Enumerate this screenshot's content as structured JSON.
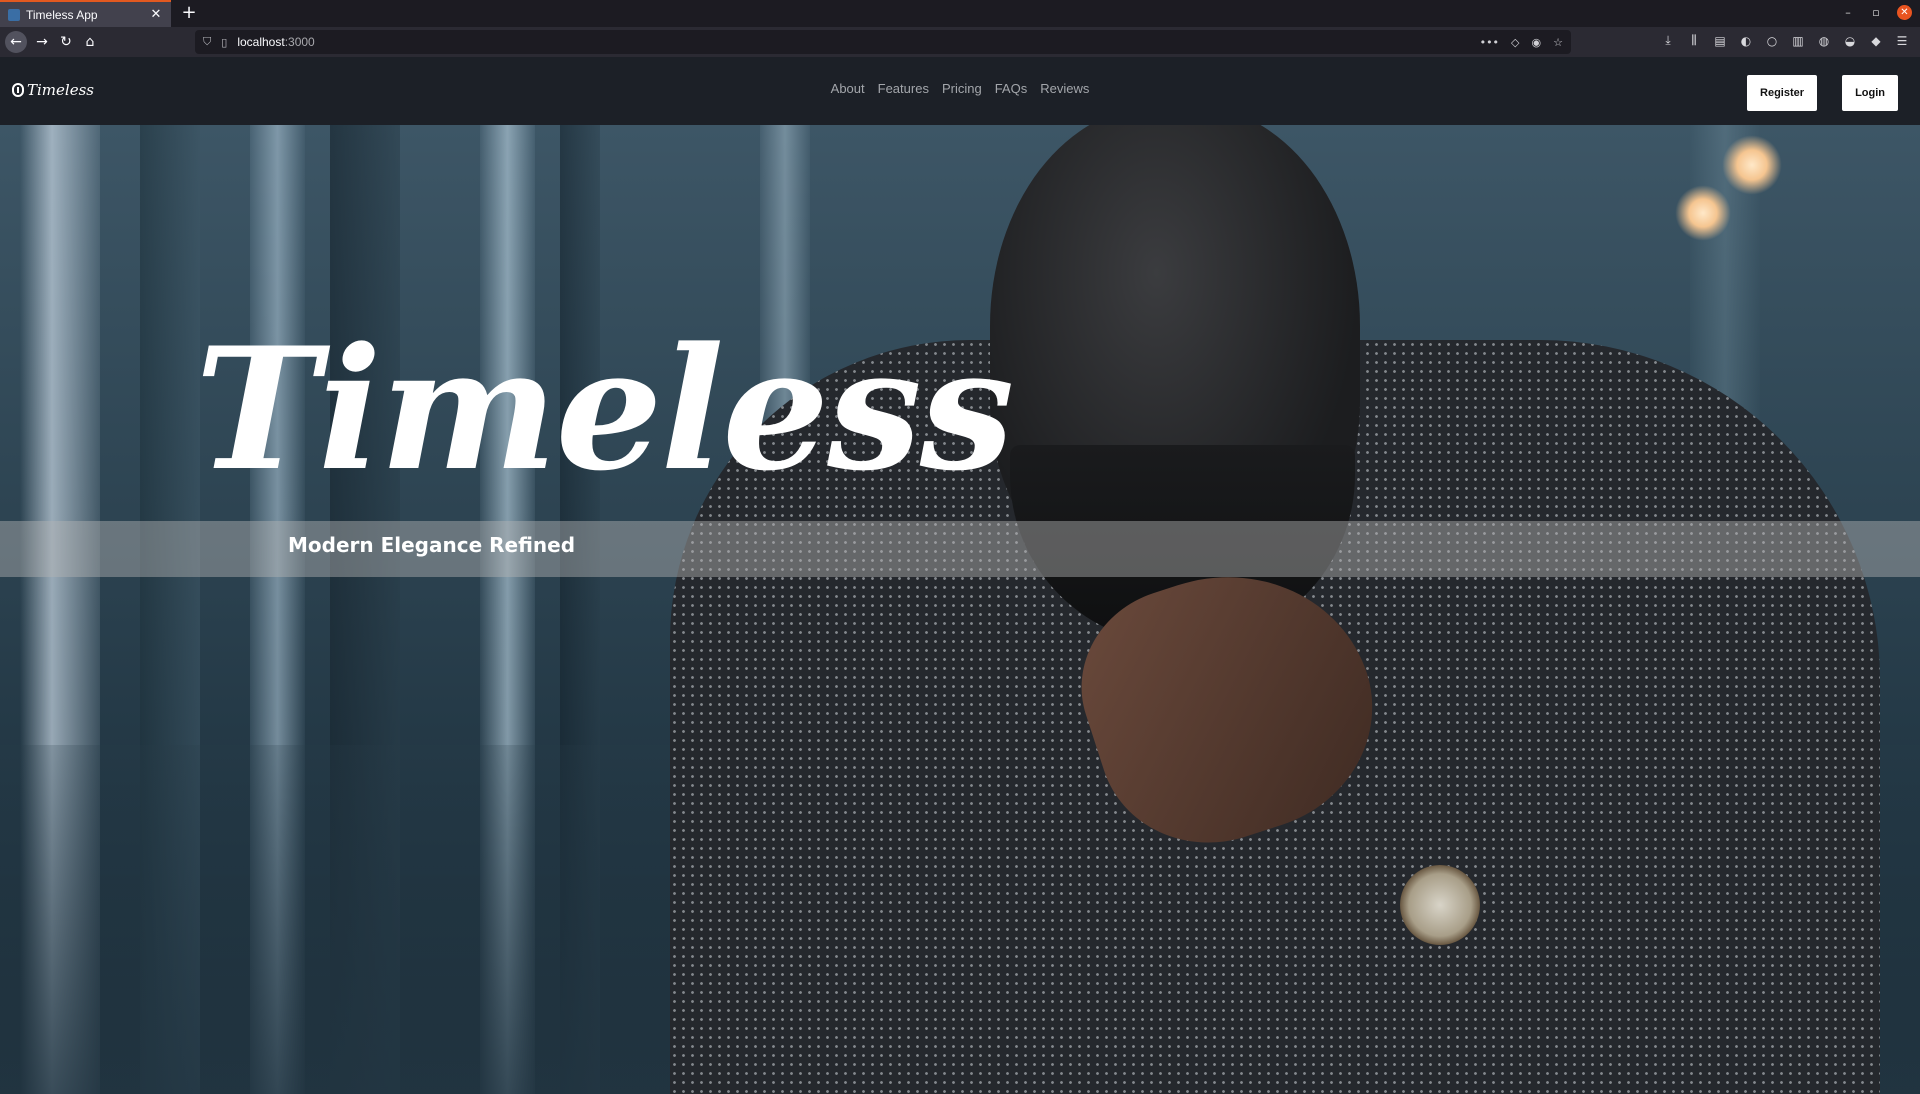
{
  "browser": {
    "tab": {
      "title": "Timeless App",
      "close": "✕"
    },
    "new_tab": "+",
    "url": {
      "host": "localhost",
      "port": ":3000"
    },
    "window_controls": {
      "minimize": "–",
      "restore": "▫",
      "close": "✕"
    }
  },
  "site": {
    "brand": "Timeless",
    "nav": {
      "about": "About",
      "features": "Features",
      "pricing": "Pricing",
      "faqs": "FAQs",
      "reviews": "Reviews"
    },
    "auth": {
      "register": "Register",
      "login": "Login"
    }
  },
  "hero": {
    "title": "Timeless",
    "tagline": "Modern Elegance Refined"
  },
  "colors": {
    "tab_accent": "#e25920",
    "header_bg": "#1c2027",
    "nav_text": "#a3a6ab",
    "button_bg": "#ffffff"
  }
}
